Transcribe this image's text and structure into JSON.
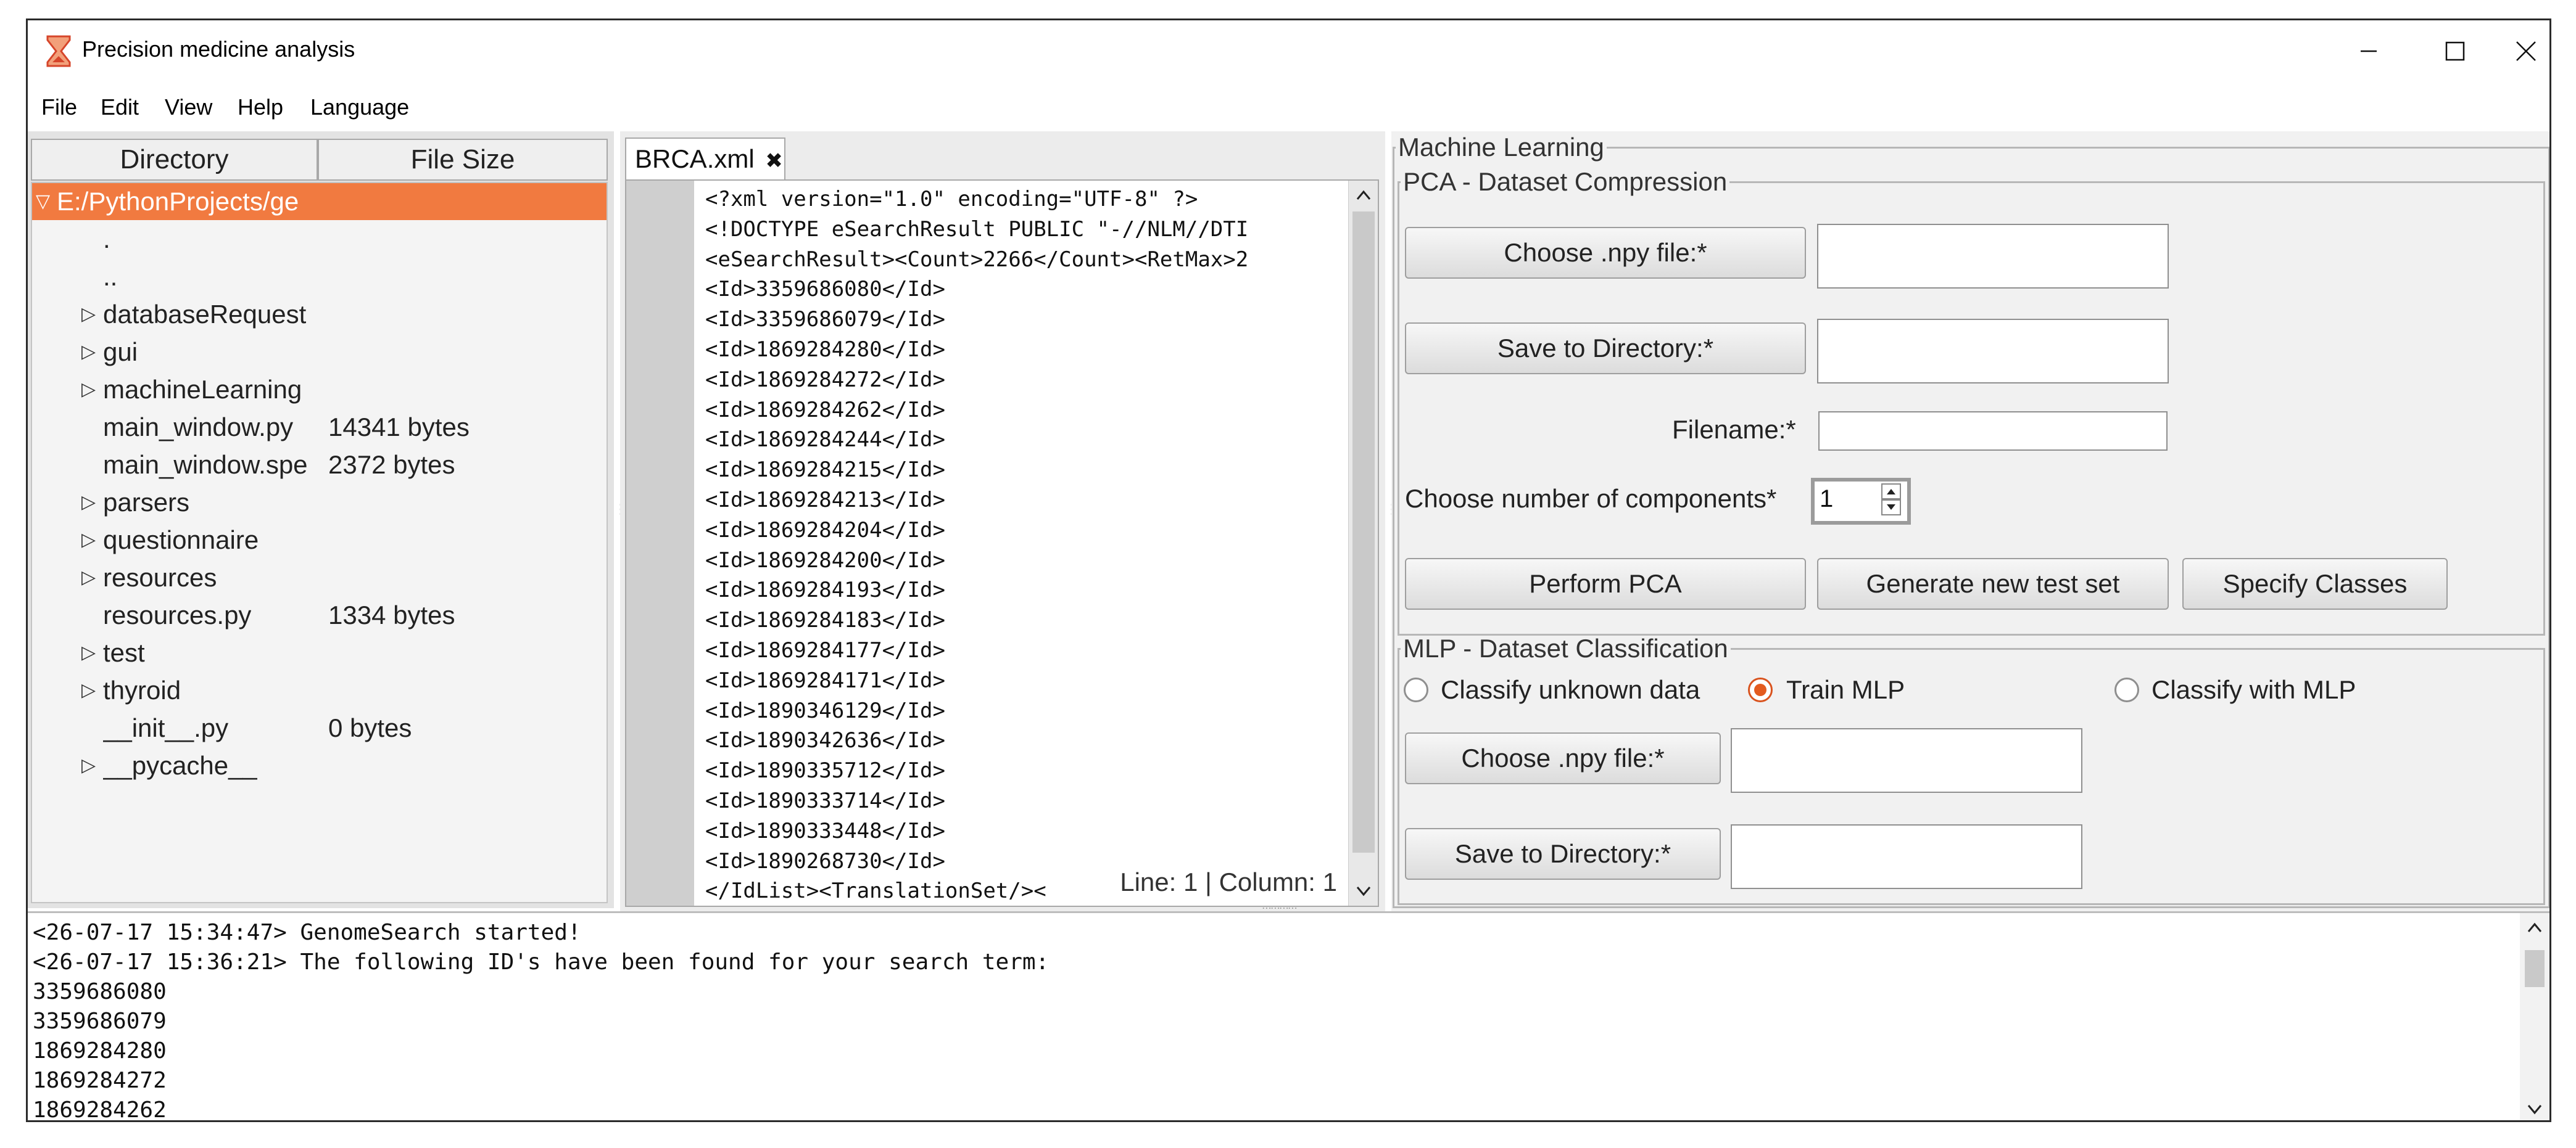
{
  "window": {
    "title": "Precision medicine analysis",
    "icons": {
      "app": "hourglass-icon",
      "minimize": "minimize-icon",
      "maximize": "maximize-icon",
      "close": "close-icon"
    }
  },
  "menu": [
    "File",
    "Edit",
    "View",
    "Help",
    "Language"
  ],
  "tree": {
    "headers": [
      "Directory",
      "File Size"
    ],
    "rows": [
      {
        "name": "E:/PythonProjects/ge",
        "size": "",
        "arrow": "▽",
        "selected": true
      },
      {
        "name": ".",
        "size": "",
        "arrow": ""
      },
      {
        "name": "..",
        "size": "",
        "arrow": ""
      },
      {
        "name": "databaseRequest",
        "size": "",
        "arrow": "▷"
      },
      {
        "name": "gui",
        "size": "",
        "arrow": "▷"
      },
      {
        "name": "machineLearning",
        "size": "",
        "arrow": "▷"
      },
      {
        "name": "main_window.py",
        "size": "14341 bytes",
        "arrow": ""
      },
      {
        "name": "main_window.spe",
        "size": "2372 bytes",
        "arrow": ""
      },
      {
        "name": "parsers",
        "size": "",
        "arrow": "▷"
      },
      {
        "name": "questionnaire",
        "size": "",
        "arrow": "▷"
      },
      {
        "name": "resources",
        "size": "",
        "arrow": "▷"
      },
      {
        "name": "resources.py",
        "size": "1334 bytes",
        "arrow": ""
      },
      {
        "name": "test",
        "size": "",
        "arrow": "▷"
      },
      {
        "name": "thyroid",
        "size": "",
        "arrow": "▷"
      },
      {
        "name": "__init__.py",
        "size": "0 bytes",
        "arrow": ""
      },
      {
        "name": "__pycache__",
        "size": "",
        "arrow": "▷"
      }
    ]
  },
  "editor": {
    "tab_label": "BRCA.xml",
    "tab_close_glyph": "✖",
    "lines": [
      "<?xml version=\"1.0\" encoding=\"UTF-8\" ?>",
      "<!DOCTYPE eSearchResult PUBLIC \"-//NLM//DTI",
      "<eSearchResult><Count>2266</Count><RetMax>2",
      "<Id>3359686080</Id>",
      "<Id>3359686079</Id>",
      "<Id>1869284280</Id>",
      "<Id>1869284272</Id>",
      "<Id>1869284262</Id>",
      "<Id>1869284244</Id>",
      "<Id>1869284215</Id>",
      "<Id>1869284213</Id>",
      "<Id>1869284204</Id>",
      "<Id>1869284200</Id>",
      "<Id>1869284193</Id>",
      "<Id>1869284183</Id>",
      "<Id>1869284177</Id>",
      "<Id>1869284171</Id>",
      "<Id>1890346129</Id>",
      "<Id>1890342636</Id>",
      "<Id>1890335712</Id>",
      "<Id>1890333714</Id>",
      "<Id>1890333448</Id>",
      "<Id>1890268730</Id>",
      "</IdList><TranslationSet/><"
    ],
    "status": "Line: 1 | Column: 1"
  },
  "ml": {
    "title": "Machine Learning",
    "pca": {
      "title": "PCA - Dataset Compression",
      "choose_npy": "Choose .npy file:*",
      "save_dir": "Save to Directory:*",
      "filename_label": "Filename:*",
      "components_label": "Choose number of components*",
      "components_value": "1",
      "perform": "Perform PCA",
      "generate": "Generate new test set",
      "specify": "Specify Classes"
    },
    "mlp": {
      "title": "MLP - Dataset Classification",
      "radio_unknown": "Classify unknown data",
      "radio_train": "Train MLP",
      "radio_classify": "Classify with MLP",
      "choose_npy": "Choose .npy file:*",
      "save_dir": "Save to Directory:*"
    }
  },
  "console": {
    "lines": [
      "<26-07-17 15:34:47> GenomeSearch started!",
      "<26-07-17 15:36:21> The following ID's have been found for your search term:",
      "3359686080",
      "3359686079",
      "1869284280",
      "1869284272",
      "1869284262"
    ]
  }
}
